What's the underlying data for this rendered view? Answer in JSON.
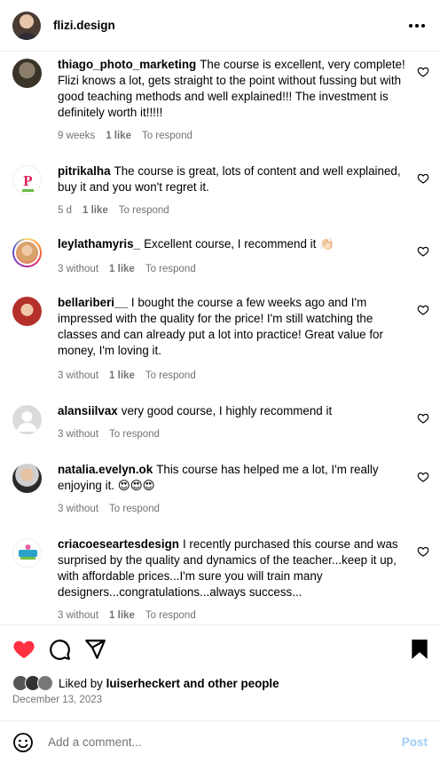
{
  "header": {
    "username": "flizi.design",
    "more_icon": "more-horizontal-icon"
  },
  "comments": [
    {
      "user": "thiago_photo_marketing",
      "text": "The course is excellent, very complete! Flizi knows a lot, gets straight to the point without fussing but with good teaching methods and well explained!!! The investment is definitely worth it!!!!!",
      "time": "9 weeks",
      "likes": "1 like",
      "reply": "To respond"
    },
    {
      "user": "pitrikalha",
      "text": "The course is great, lots of content and well explained, buy it and you won't regret it.",
      "time": "5 d",
      "likes": "1 like",
      "reply": "To respond"
    },
    {
      "user": "leylathamyris_",
      "text": "Excellent course, I recommend it 👏🏻",
      "time": "3 without",
      "likes": "1 like",
      "reply": "To respond"
    },
    {
      "user": "bellariberi__",
      "text": "I bought the course a few weeks ago and I'm impressed with the quality for the price! I'm still watching the classes and can already put a lot into practice! Great value for money, I'm loving it.",
      "time": "3 without",
      "likes": "1 like",
      "reply": "To respond"
    },
    {
      "user": "alansiilvax",
      "text": "very good course, I highly recommend it",
      "time": "3 without",
      "likes": "",
      "reply": "To respond"
    },
    {
      "user": "natalia.evelyn.ok",
      "text": "This course has helped me a lot, I'm really enjoying it. 😍😍😍",
      "time": "3 without",
      "likes": "",
      "reply": "To respond"
    },
    {
      "user": "criacoeseartesdesign",
      "text": "I recently purchased this course and was surprised by the quality and dynamics of the teacher...keep it up, with affordable prices...I'm sure you will train many designers...congratulations...always success...",
      "time": "3 without",
      "likes": "1 like",
      "reply": "To respond"
    }
  ],
  "actions": {
    "like_color": "#ff3040"
  },
  "liked_by": {
    "prefix": "Liked by",
    "user": "luiserheckert",
    "suffix": "and other people"
  },
  "date": "December 13, 2023",
  "add_comment": {
    "placeholder": "Add a comment...",
    "post_label": "Post"
  }
}
